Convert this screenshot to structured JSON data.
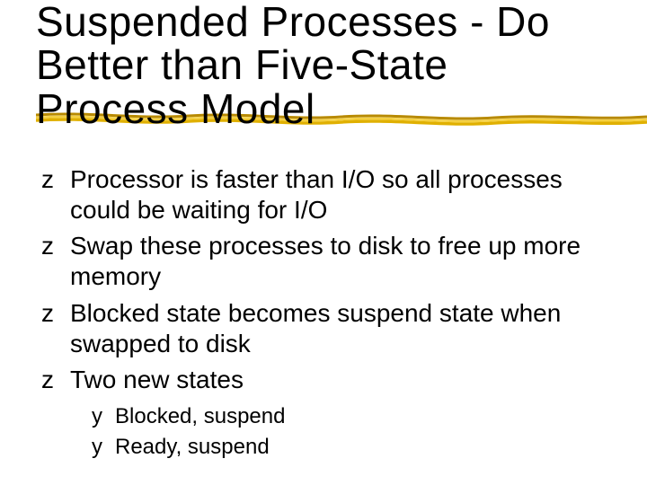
{
  "title": "Suspended Processes - Do Better than Five-State Process Model",
  "bullets": [
    {
      "text": "Processor is faster than I/O so all processes could be waiting for I/O"
    },
    {
      "text": "Swap these processes to disk to free up more memory"
    },
    {
      "text": "Blocked state becomes suspend state when swapped to disk"
    },
    {
      "text": "Two new states",
      "sub": [
        {
          "text": "Blocked, suspend"
        },
        {
          "text": "Ready, suspend"
        }
      ]
    }
  ]
}
